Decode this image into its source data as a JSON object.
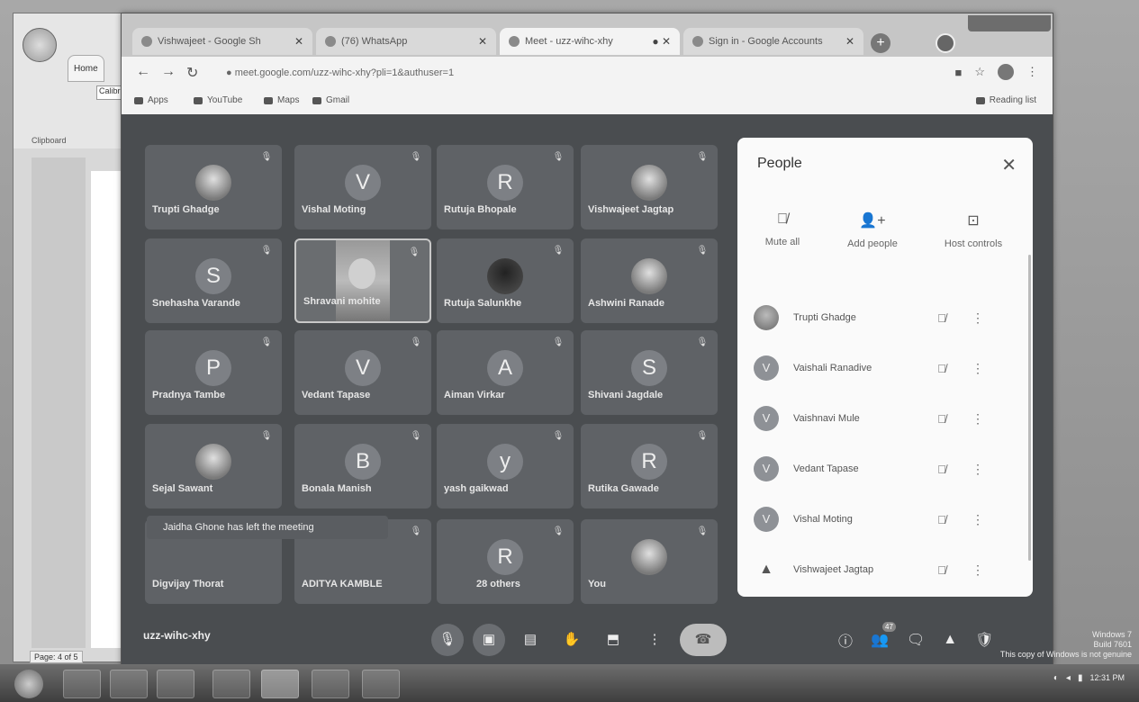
{
  "word": {
    "tab": "Home",
    "font": "Calibri",
    "clipboard": "Clipboard",
    "pager": "Page: 4 of 5"
  },
  "browser": {
    "tabs": [
      {
        "label": "Vishwajeet - Google Sh"
      },
      {
        "label": "(76) WhatsApp"
      },
      {
        "label": "Meet - uzz-wihc-xhy"
      },
      {
        "label": "Sign in - Google Accounts"
      }
    ],
    "url": "meet.google.com/uzz-wihc-xhy?pli=1&authuser=1",
    "bookmarks": [
      "Apps",
      "YouTube",
      "Maps",
      "Gmail"
    ],
    "reading_list": "Reading list"
  },
  "meet": {
    "tiles": [
      {
        "name": "Trupti Ghadge",
        "initial": ""
      },
      {
        "name": "Vishal Moting",
        "initial": "V"
      },
      {
        "name": "Rutuja Bhopale",
        "initial": "R"
      },
      {
        "name": "Vishwajeet Jagtap",
        "initial": ""
      },
      {
        "name": "Snehasha Varande",
        "initial": "S"
      },
      {
        "name": "Shravani mohite",
        "initial": ""
      },
      {
        "name": "Rutuja Salunkhe",
        "initial": ""
      },
      {
        "name": "Ashwini Ranade",
        "initial": ""
      },
      {
        "name": "Pradnya Tambe",
        "initial": "P"
      },
      {
        "name": "Vedant Tapase",
        "initial": "V"
      },
      {
        "name": "Aiman Virkar",
        "initial": "A"
      },
      {
        "name": "Shivani Jagdale",
        "initial": "S"
      },
      {
        "name": "Sejal Sawant",
        "initial": ""
      },
      {
        "name": "Bonala Manish",
        "initial": "B"
      },
      {
        "name": "yash gaikwad",
        "initial": "y"
      },
      {
        "name": "Rutika Gawade",
        "initial": "R"
      },
      {
        "name": "Digvijay Thorat",
        "initial": ""
      },
      {
        "name": "ADITYA KAMBLE",
        "initial": ""
      },
      {
        "name": "28 others",
        "initial": "R"
      },
      {
        "name": "You",
        "initial": ""
      }
    ],
    "toast": "Jaidha Ghone has left the meeting",
    "meeting_code": "uzz-wihc-xhy",
    "people_count": "47"
  },
  "people": {
    "title": "People",
    "actions": {
      "mute_all": "Mute all",
      "add_people": "Add people",
      "host_controls": "Host controls"
    },
    "list": [
      {
        "name": "Trupti Ghadge",
        "initial": ""
      },
      {
        "name": "Vaishali Ranadive",
        "initial": "V"
      },
      {
        "name": "Vaishnavi Mule",
        "initial": "V"
      },
      {
        "name": "Vedant Tapase",
        "initial": "V"
      },
      {
        "name": "Vishal Moting",
        "initial": "V"
      },
      {
        "name": "Vishwajeet Jagtap",
        "initial": "▲"
      }
    ]
  },
  "taskbar": {
    "clock_time": "12:31 PM",
    "watermark_lines": [
      "Windows 7",
      "Build 7601",
      "This copy of Windows is not genuine"
    ]
  },
  "colors": {
    "meet_bg": "#4a4d50",
    "panel_bg": "#fafafa",
    "tile_bg": "#5f6266"
  }
}
